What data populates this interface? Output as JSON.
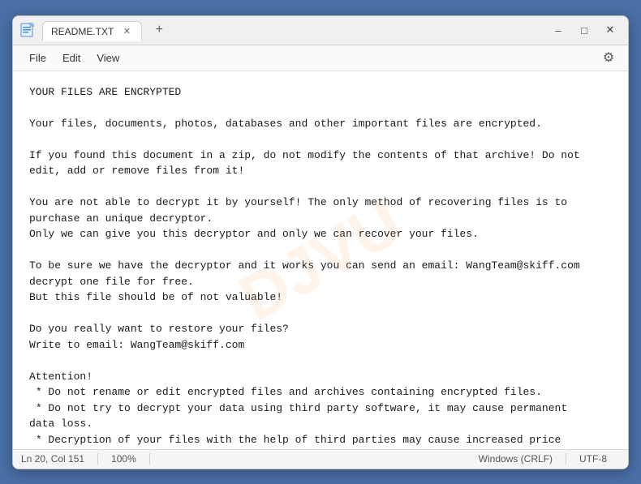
{
  "window": {
    "title": "README.TXT",
    "tab_label": "README.TXT",
    "new_tab_label": "+",
    "minimize_label": "–",
    "maximize_label": "□",
    "close_label": "✕"
  },
  "menu": {
    "file": "File",
    "edit": "Edit",
    "view": "View"
  },
  "content": {
    "text": "YOUR FILES ARE ENCRYPTED\n\nYour files, documents, photos, databases and other important files are encrypted.\n\nIf you found this document in a zip, do not modify the contents of that archive! Do not\nedit, add or remove files from it!\n\nYou are not able to decrypt it by yourself! The only method of recovering files is to\npurchase an unique decryptor.\nOnly we can give you this decryptor and only we can recover your files.\n\nTo be sure we have the decryptor and it works you can send an email: WangTeam@skiff.com\ndecrypt one file for free.\nBut this file should be of not valuable!\n\nDo you really want to restore your files?\nWrite to email: WangTeam@skiff.com\n\nAttention!\n * Do not rename or edit encrypted files and archives containing encrypted files.\n * Do not try to decrypt your data using third party software, it may cause permanent\ndata loss.\n * Decryption of your files with the help of third parties may cause increased price\n(they add their fee to our) or you can become a victim of a scam.",
    "watermark": "DJVU"
  },
  "status_bar": {
    "position": "Ln 20, Col 151",
    "zoom": "100%",
    "line_ending": "Windows (CRLF)",
    "encoding": "UTF-8"
  }
}
